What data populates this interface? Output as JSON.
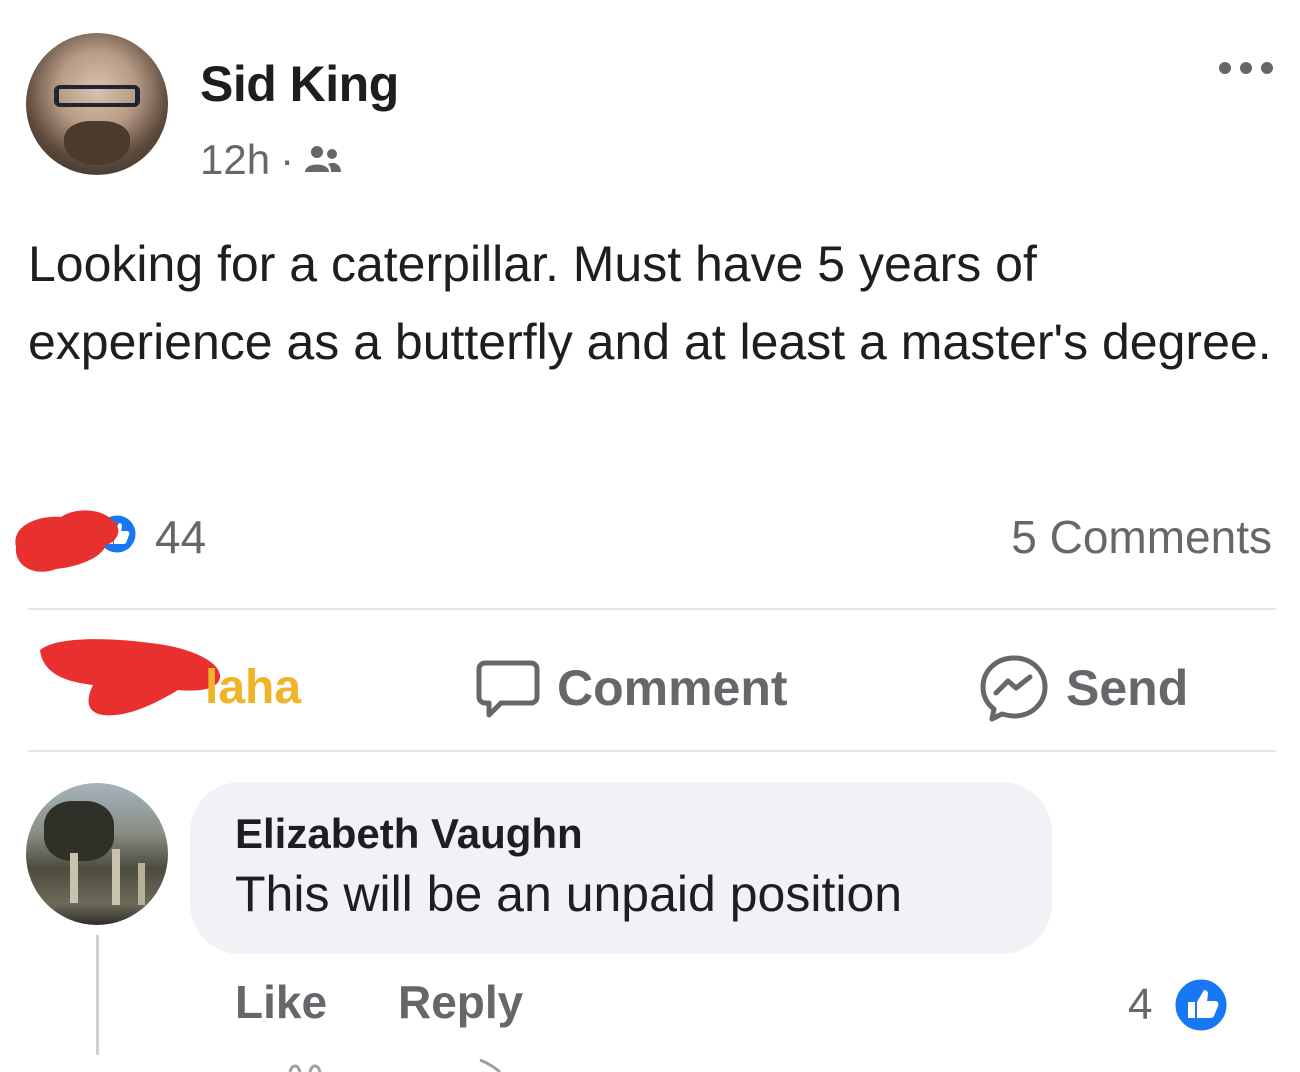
{
  "post": {
    "author": "Sid King",
    "time": "12h",
    "separator": "·",
    "audience_icon": "friends-icon",
    "more_icon": "more-dots-icon",
    "text": "Looking for a caterpillar. Must have 5 years of experience as a butterfly and at least a master's degree.",
    "reaction_count": "44",
    "comments_count": "5 Comments"
  },
  "actions": {
    "haha_label": "laha",
    "comment_label": "Comment",
    "send_label": "Send"
  },
  "comment": {
    "author": "Elizabeth Vaughn",
    "text": "This will be an unpaid position",
    "like_label": "Like",
    "reply_label": "Reply",
    "reaction_count": "4"
  },
  "colors": {
    "like_blue": "#1877f2",
    "redaction_red": "#e8312f",
    "haha_yellow": "#f0b429",
    "secondary_text": "#65676b",
    "bubble_bg": "#f0f2f5"
  }
}
